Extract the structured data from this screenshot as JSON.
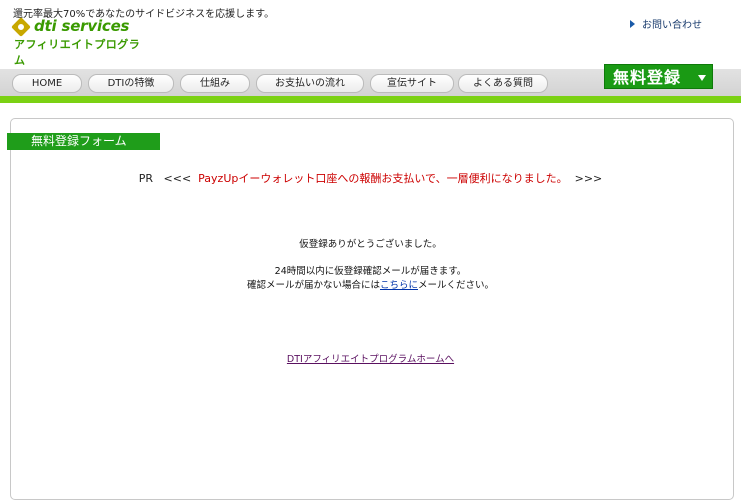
{
  "header": {
    "tagline": "還元率最大70%であなたのサイドビジネスを応援します。",
    "logo_text": "dti services",
    "logo_sub": "アフィリエイトプログラム",
    "contact_label": "お問い合わせ"
  },
  "nav": {
    "items": [
      {
        "label": "HOME"
      },
      {
        "label": "DTIの特徴"
      },
      {
        "label": "仕組み"
      },
      {
        "label": "お支払いの流れ"
      },
      {
        "label": "宣伝サイト"
      },
      {
        "label": "よくある質問"
      }
    ],
    "signup_label": "無料登録"
  },
  "form": {
    "title": "無料登録フォーム",
    "pr_prefix": "PR",
    "pr_open": "<<<",
    "pr_text": "PayzUpイーウォレット口座への報酬お支払いで、一層便利になりました。",
    "pr_close": ">>>",
    "thanks": "仮登録ありがとうございました。",
    "notice1": "24時間以内に仮登録確認メールが届きます。",
    "notice2_before": "確認メールが届かない場合には",
    "notice2_link": "こちらに",
    "notice2_after": "メールください。",
    "home_link": "DTIアフィリエイトプログラムホームへ"
  },
  "colors": {
    "accent_green": "#7bd113",
    "button_green": "#1a9a14",
    "pr_red": "#cc0000"
  }
}
